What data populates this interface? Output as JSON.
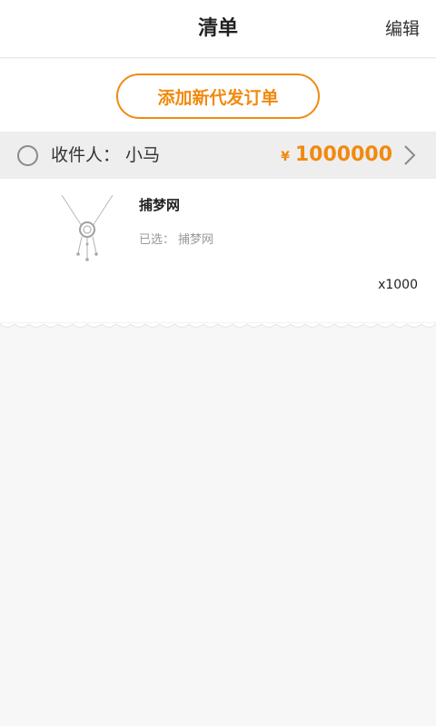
{
  "header": {
    "title": "清单",
    "edit_label": "编辑"
  },
  "add_order": {
    "label": "添加新代发订单"
  },
  "recipient": {
    "label": "收件人：",
    "name": "小马",
    "currency": "¥",
    "total": "1000000"
  },
  "product": {
    "name": "捕梦网",
    "option_label": "已选：",
    "option_value": "捕梦网",
    "quantity": "x1000"
  },
  "colors": {
    "accent": "#f08a10",
    "bar_bg": "#eeeeee",
    "page_bg": "#f7f7f7"
  },
  "icons": {
    "select": "radio-circle-icon",
    "detail": "chevron-right-icon"
  }
}
